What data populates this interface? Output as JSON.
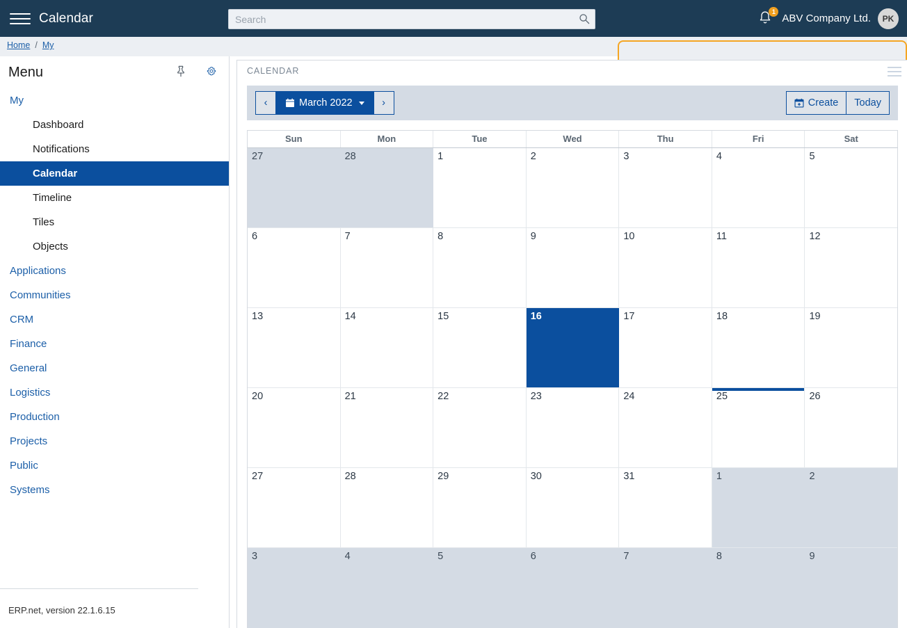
{
  "topbar": {
    "menu_icon": "hamburger-icon",
    "app_title": "Calendar",
    "search_placeholder": "Search",
    "search_value": "",
    "search_icon": "search-icon",
    "bell_icon": "bell-icon",
    "notification_count": "1",
    "company_name": "ABV Company Ltd.",
    "avatar_initials": "PK"
  },
  "breadcrumb": {
    "items": [
      {
        "label": "Home"
      },
      {
        "label": "My"
      }
    ],
    "separator": "/"
  },
  "sidebar": {
    "title": "Menu",
    "pin_icon": "pin-icon",
    "settings_icon": "gear-icon",
    "groups": [
      {
        "label": "My",
        "items": [
          {
            "label": "Dashboard",
            "active": false
          },
          {
            "label": "Notifications",
            "active": false
          },
          {
            "label": "Calendar",
            "active": true
          },
          {
            "label": "Timeline",
            "active": false
          },
          {
            "label": "Tiles",
            "active": false
          },
          {
            "label": "Objects",
            "active": false
          }
        ]
      },
      {
        "label": "Applications",
        "items": []
      },
      {
        "label": "Communities",
        "items": []
      },
      {
        "label": "CRM",
        "items": []
      },
      {
        "label": "Finance",
        "items": []
      },
      {
        "label": "General",
        "items": []
      },
      {
        "label": "Logistics",
        "items": []
      },
      {
        "label": "Production",
        "items": []
      },
      {
        "label": "Projects",
        "items": []
      },
      {
        "label": "Public",
        "items": []
      },
      {
        "label": "Systems",
        "items": []
      }
    ],
    "footer": "ERP.net, version 22.1.6.15"
  },
  "panel": {
    "title": "CALENDAR",
    "menu_icon": "panel-menu-icon"
  },
  "toolbar": {
    "prev_label": "‹",
    "next_label": "›",
    "period_label": "March 2022",
    "period_icon": "calendar-icon",
    "create_label": "Create",
    "create_icon": "calendar-plus-icon",
    "today_label": "Today"
  },
  "calendar": {
    "month": "March",
    "year": "2022",
    "weekday_headers": [
      "Sun",
      "Mon",
      "Tue",
      "Wed",
      "Thu",
      "Fri",
      "Sat"
    ],
    "selected_day": "16",
    "today_day": "25",
    "weeks": [
      [
        {
          "n": "27",
          "other": true
        },
        {
          "n": "28",
          "other": true
        },
        {
          "n": "1"
        },
        {
          "n": "2"
        },
        {
          "n": "3"
        },
        {
          "n": "4"
        },
        {
          "n": "5"
        }
      ],
      [
        {
          "n": "6"
        },
        {
          "n": "7"
        },
        {
          "n": "8"
        },
        {
          "n": "9"
        },
        {
          "n": "10"
        },
        {
          "n": "11"
        },
        {
          "n": "12"
        }
      ],
      [
        {
          "n": "13"
        },
        {
          "n": "14"
        },
        {
          "n": "15"
        },
        {
          "n": "16",
          "selected": true
        },
        {
          "n": "17"
        },
        {
          "n": "18"
        },
        {
          "n": "19"
        }
      ],
      [
        {
          "n": "20"
        },
        {
          "n": "21"
        },
        {
          "n": "22"
        },
        {
          "n": "23"
        },
        {
          "n": "24"
        },
        {
          "n": "25",
          "today": true
        },
        {
          "n": "26"
        }
      ],
      [
        {
          "n": "27"
        },
        {
          "n": "28"
        },
        {
          "n": "29"
        },
        {
          "n": "30"
        },
        {
          "n": "31"
        },
        {
          "n": "1",
          "other": true
        },
        {
          "n": "2",
          "other": true
        }
      ],
      [
        {
          "n": "3",
          "other": true
        },
        {
          "n": "4",
          "other": true
        },
        {
          "n": "5",
          "other": true
        },
        {
          "n": "6",
          "other": true
        },
        {
          "n": "7",
          "other": true
        },
        {
          "n": "8",
          "other": true
        },
        {
          "n": "9",
          "other": true
        }
      ]
    ]
  },
  "colors": {
    "topbar_bg": "#1d3c55",
    "accent_blue": "#0b4f9e",
    "link_blue": "#1c5fa8",
    "badge_orange": "#f0a020",
    "tab_orange": "#f5a623",
    "muted_cell": "#d4dbe4",
    "toolbar_bg": "#d4dbe4"
  }
}
